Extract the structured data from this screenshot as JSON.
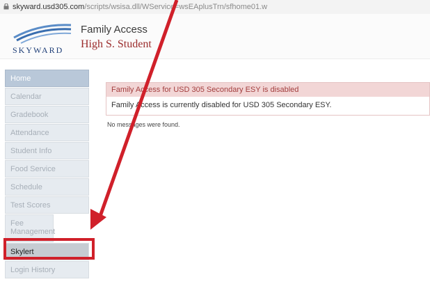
{
  "browser": {
    "url_host": "skyward.usd305.com",
    "url_path": "/scripts/wsisa.dll/WService=wsEAplusTrn/sfhome01.w"
  },
  "header": {
    "logo_text": "SKYWARD",
    "app_title": "Family Access",
    "student_name": "High S. Student"
  },
  "sidebar": {
    "items": [
      {
        "label": "Home",
        "active": true
      },
      {
        "label": "Calendar"
      },
      {
        "label": "Gradebook"
      },
      {
        "label": "Attendance"
      },
      {
        "label": "Student Info"
      },
      {
        "label": "Food Service"
      },
      {
        "label": "Schedule"
      },
      {
        "label": "Test Scores"
      },
      {
        "label": "Fee Management"
      },
      {
        "label": "Skylert",
        "highlighted": true
      },
      {
        "label": "Login History"
      }
    ]
  },
  "alert": {
    "title": "Family Access for USD 305 Secondary ESY is disabled",
    "message": "Family Access is currently disabled for USD 305 Secondary ESY."
  },
  "messages": {
    "empty_text": "No messages were found."
  },
  "colors": {
    "annotation": "#d0202a",
    "alert_header_bg": "#f2d6d6",
    "alert_text": "#a33e3e",
    "nav_active_bg": "#b9c8d9"
  },
  "icons": [
    "lock-icon",
    "skyward-logo"
  ]
}
